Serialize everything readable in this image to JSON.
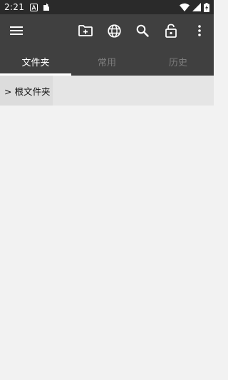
{
  "status_bar": {
    "time": "2:21",
    "left_icons": [
      "notification-a-icon",
      "file-transfer-icon"
    ],
    "right_icons": [
      "wifi-icon",
      "cellular-signal-icon",
      "battery-charging-icon"
    ]
  },
  "toolbar": {
    "menu_icon": "menu-icon",
    "actions": [
      "new-folder-icon",
      "globe-icon",
      "search-icon",
      "lock-open-icon",
      "more-vert-icon"
    ]
  },
  "tabs": [
    {
      "label": "文件夹",
      "active": true
    },
    {
      "label": "常用",
      "active": false
    },
    {
      "label": "历史",
      "active": false
    }
  ],
  "breadcrumb": {
    "root_label": "> 根文件夹"
  },
  "colors": {
    "status_bar": "#2a2a2a",
    "toolbar": "#404040",
    "tab_active": "#ffffff",
    "tab_inactive": "#7c7c7c",
    "background": "#f2f2f2"
  }
}
